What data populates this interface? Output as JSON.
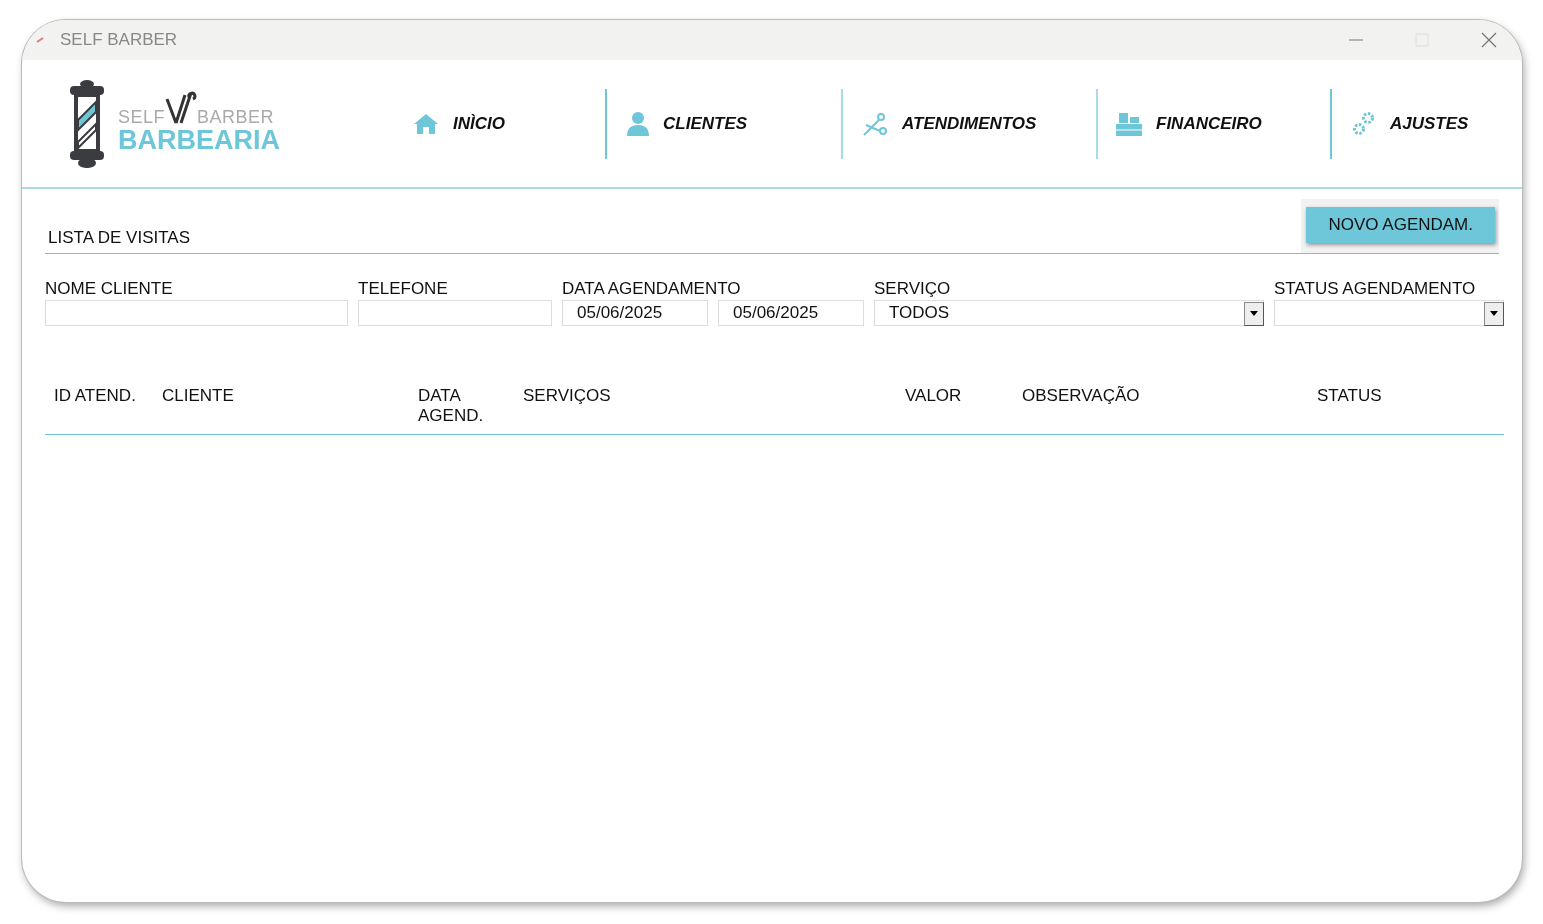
{
  "window": {
    "title": "SELF BARBER"
  },
  "logo": {
    "top_left": "SELF",
    "top_right": "BARBER",
    "bottom": "BARBEARIA"
  },
  "nav": [
    {
      "kind": "home",
      "label": "INÌCIO"
    },
    {
      "kind": "person",
      "label": "CLIENTES"
    },
    {
      "kind": "scissors",
      "label": "ATENDIMENTOS"
    },
    {
      "kind": "register",
      "label": "FINANCEIRO"
    },
    {
      "kind": "gears",
      "label": "AJUSTES"
    }
  ],
  "section_title": "LISTA DE VISITAS",
  "new_button": "NOVO AGENDAM.",
  "filters": [
    {
      "kind": "text",
      "label": "NOME CLIENTE"
    },
    {
      "kind": "text",
      "label": "TELEFONE"
    },
    {
      "kind": "dates",
      "label": "DATA AGENDAMENTO",
      "values": [
        "05/06/2025",
        "05/06/2025"
      ]
    },
    {
      "kind": "select",
      "label": "SERVIÇO",
      "value": "TODOS"
    },
    {
      "kind": "select",
      "label": "STATUS AGENDAMENTO"
    }
  ],
  "table": {
    "columns": [
      "ID ATEND.",
      "CLIENTE",
      "DATA AGEND.",
      "SERVIÇOS",
      "VALOR",
      "OBSERVAÇÃO",
      "STATUS"
    ]
  }
}
